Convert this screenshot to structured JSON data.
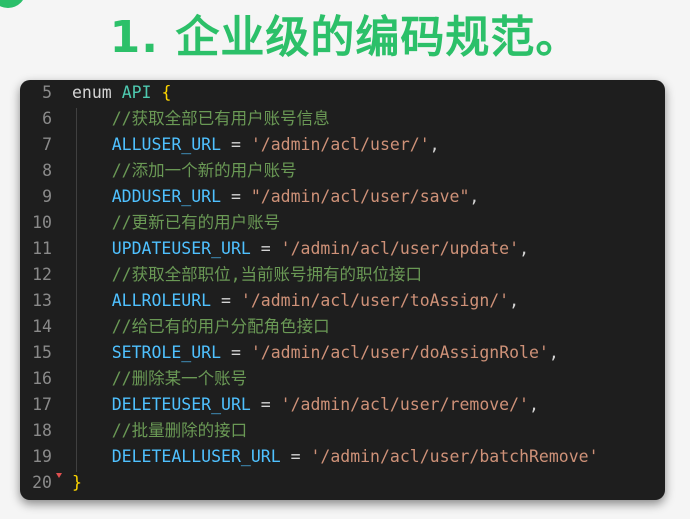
{
  "heading": "1. 企业级的编码规范。",
  "editor": {
    "lines": [
      {
        "num": "5",
        "kind": "open",
        "keyword": "enum",
        "name": "API",
        "brace": "{"
      },
      {
        "num": "6",
        "kind": "comment",
        "text": "//获取全部已有用户账号信息"
      },
      {
        "num": "7",
        "kind": "member",
        "key": "ALLUSER_URL",
        "eq": "=",
        "value": "'/admin/acl/user/'",
        "tail": ","
      },
      {
        "num": "8",
        "kind": "comment",
        "text": "//添加一个新的用户账号"
      },
      {
        "num": "9",
        "kind": "member",
        "key": "ADDUSER_URL",
        "eq": "=",
        "value": "\"/admin/acl/user/save\"",
        "tail": ","
      },
      {
        "num": "10",
        "kind": "comment",
        "text": "//更新已有的用户账号"
      },
      {
        "num": "11",
        "kind": "member",
        "key": "UPDATEUSER_URL",
        "eq": "=",
        "value": "'/admin/acl/user/update'",
        "tail": ","
      },
      {
        "num": "12",
        "kind": "comment",
        "text": "//获取全部职位,当前账号拥有的职位接口"
      },
      {
        "num": "13",
        "kind": "member",
        "key": "ALLROLEURL",
        "eq": "=",
        "value": "'/admin/acl/user/toAssign/'",
        "tail": ","
      },
      {
        "num": "14",
        "kind": "comment",
        "text": "//给已有的用户分配角色接口"
      },
      {
        "num": "15",
        "kind": "member",
        "key": "SETROLE_URL",
        "eq": "=",
        "value": "'/admin/acl/user/doAssignRole'",
        "tail": ","
      },
      {
        "num": "16",
        "kind": "comment",
        "text": "//删除某一个账号"
      },
      {
        "num": "17",
        "kind": "member",
        "key": "DELETEUSER_URL",
        "eq": "=",
        "value": "'/admin/acl/user/remove/'",
        "tail": ","
      },
      {
        "num": "18",
        "kind": "comment",
        "text": "//批量删除的接口"
      },
      {
        "num": "19",
        "kind": "member",
        "key": "DELETEALLUSER_URL",
        "eq": "=",
        "value": "'/admin/acl/user/batchRemove'",
        "tail": ""
      },
      {
        "num": "20",
        "kind": "close",
        "brace": "}"
      }
    ]
  },
  "colors": {
    "heading": "#2cc069",
    "editor_bg": "#1e1e1e",
    "comment": "#6a9955",
    "property": "#4fc1ff",
    "string": "#ce9178",
    "type": "#4ec9b0",
    "brace": "#ffd700",
    "line_number": "#8a8a8a"
  }
}
